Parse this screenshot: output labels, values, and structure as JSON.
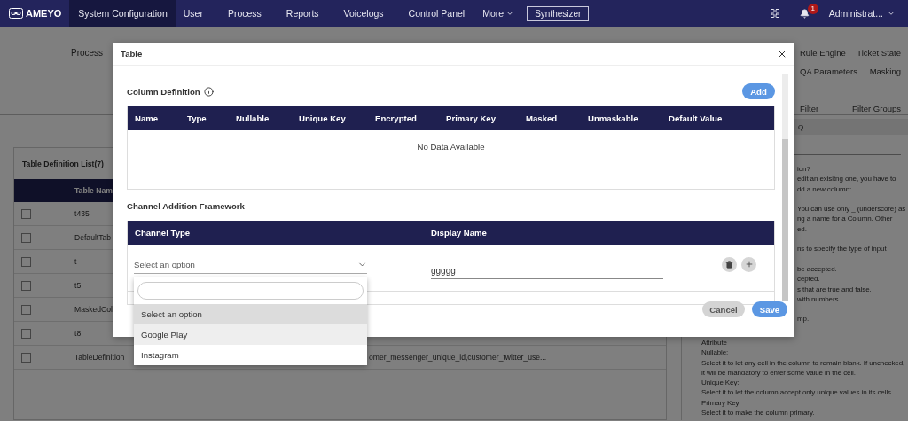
{
  "nav": {
    "logo": "AMEYO",
    "items": [
      {
        "label": "System Configuration",
        "selected": true
      },
      {
        "label": "User",
        "selected": false
      },
      {
        "label": "Process",
        "selected": false
      },
      {
        "label": "Reports",
        "selected": false
      },
      {
        "label": "Voicelogs",
        "selected": false
      },
      {
        "label": "Control Panel",
        "selected": false
      }
    ],
    "more": "More",
    "synthesizer": "Synthesizer",
    "badge": "1",
    "user": "Administrat..."
  },
  "subnav": {
    "left": [
      "Process"
    ],
    "right": [
      [
        "Rule Engine",
        "Ticket State"
      ],
      [
        "QA Parameters",
        "Masking"
      ],
      [
        "Filter",
        "Filter Groups"
      ]
    ]
  },
  "list": {
    "title": "Table Definition List(7)",
    "header": "Table Nam",
    "rows": [
      {
        "name": "t435",
        "checked": false
      },
      {
        "name": "DefaultTab",
        "checked": false
      },
      {
        "name": "t",
        "checked": false
      },
      {
        "name": "t5",
        "checked": false
      },
      {
        "name": "MaskedCol",
        "checked": false
      },
      {
        "name": "t8",
        "checked": false
      },
      {
        "name": "TableDefinition",
        "checked": false,
        "column_2": "omer_messenger_unique_id,customer_twitter_use..."
      }
    ]
  },
  "help": {
    "header": "Q",
    "partial_paragraphs": [
      [
        "ion?",
        "edit an exisitng one, you have to",
        "dd a new column:"
      ],
      [
        "You can use only _ (underscore) as",
        "ng a name for a Column. Other",
        "ed."
      ],
      [
        "ns to specify the type of input"
      ],
      [
        "be accepted.",
        "cepted.",
        "s that are true and false.",
        "with numbers."
      ],
      [
        "mp."
      ]
    ],
    "lines": [
      "Attribute",
      "Nullable:",
      "Select it to let any cell in the column to remain blank. If unchecked,",
      "it will be mandatory to enter some value in the cell.",
      "Unique Key:",
      "Select it to let the column accept only unique values in its cells.",
      "Primary Key:",
      "Select it to make the column primary."
    ]
  },
  "modal": {
    "title": "Table",
    "column_definition": {
      "title": "Column Definition",
      "add": "Add",
      "columns": [
        "Name",
        "Type",
        "Nullable",
        "Unique Key",
        "Encrypted",
        "Primary Key",
        "Masked",
        "Unmaskable",
        "Default Value"
      ],
      "empty": "No Data Available"
    },
    "channel": {
      "title": "Channel Addition Framework",
      "columns": [
        "Channel Type",
        "Display Name"
      ],
      "select_placeholder": "Select an option",
      "display_name": "ggggg"
    },
    "dropdown": {
      "options": [
        {
          "label": "Select an option",
          "selected": true,
          "highlighted": false
        },
        {
          "label": "Google Play",
          "selected": false,
          "highlighted": true
        },
        {
          "label": "Instagram",
          "selected": false,
          "highlighted": false
        }
      ]
    },
    "buttons": {
      "cancel": "Cancel",
      "save": "Save"
    }
  }
}
